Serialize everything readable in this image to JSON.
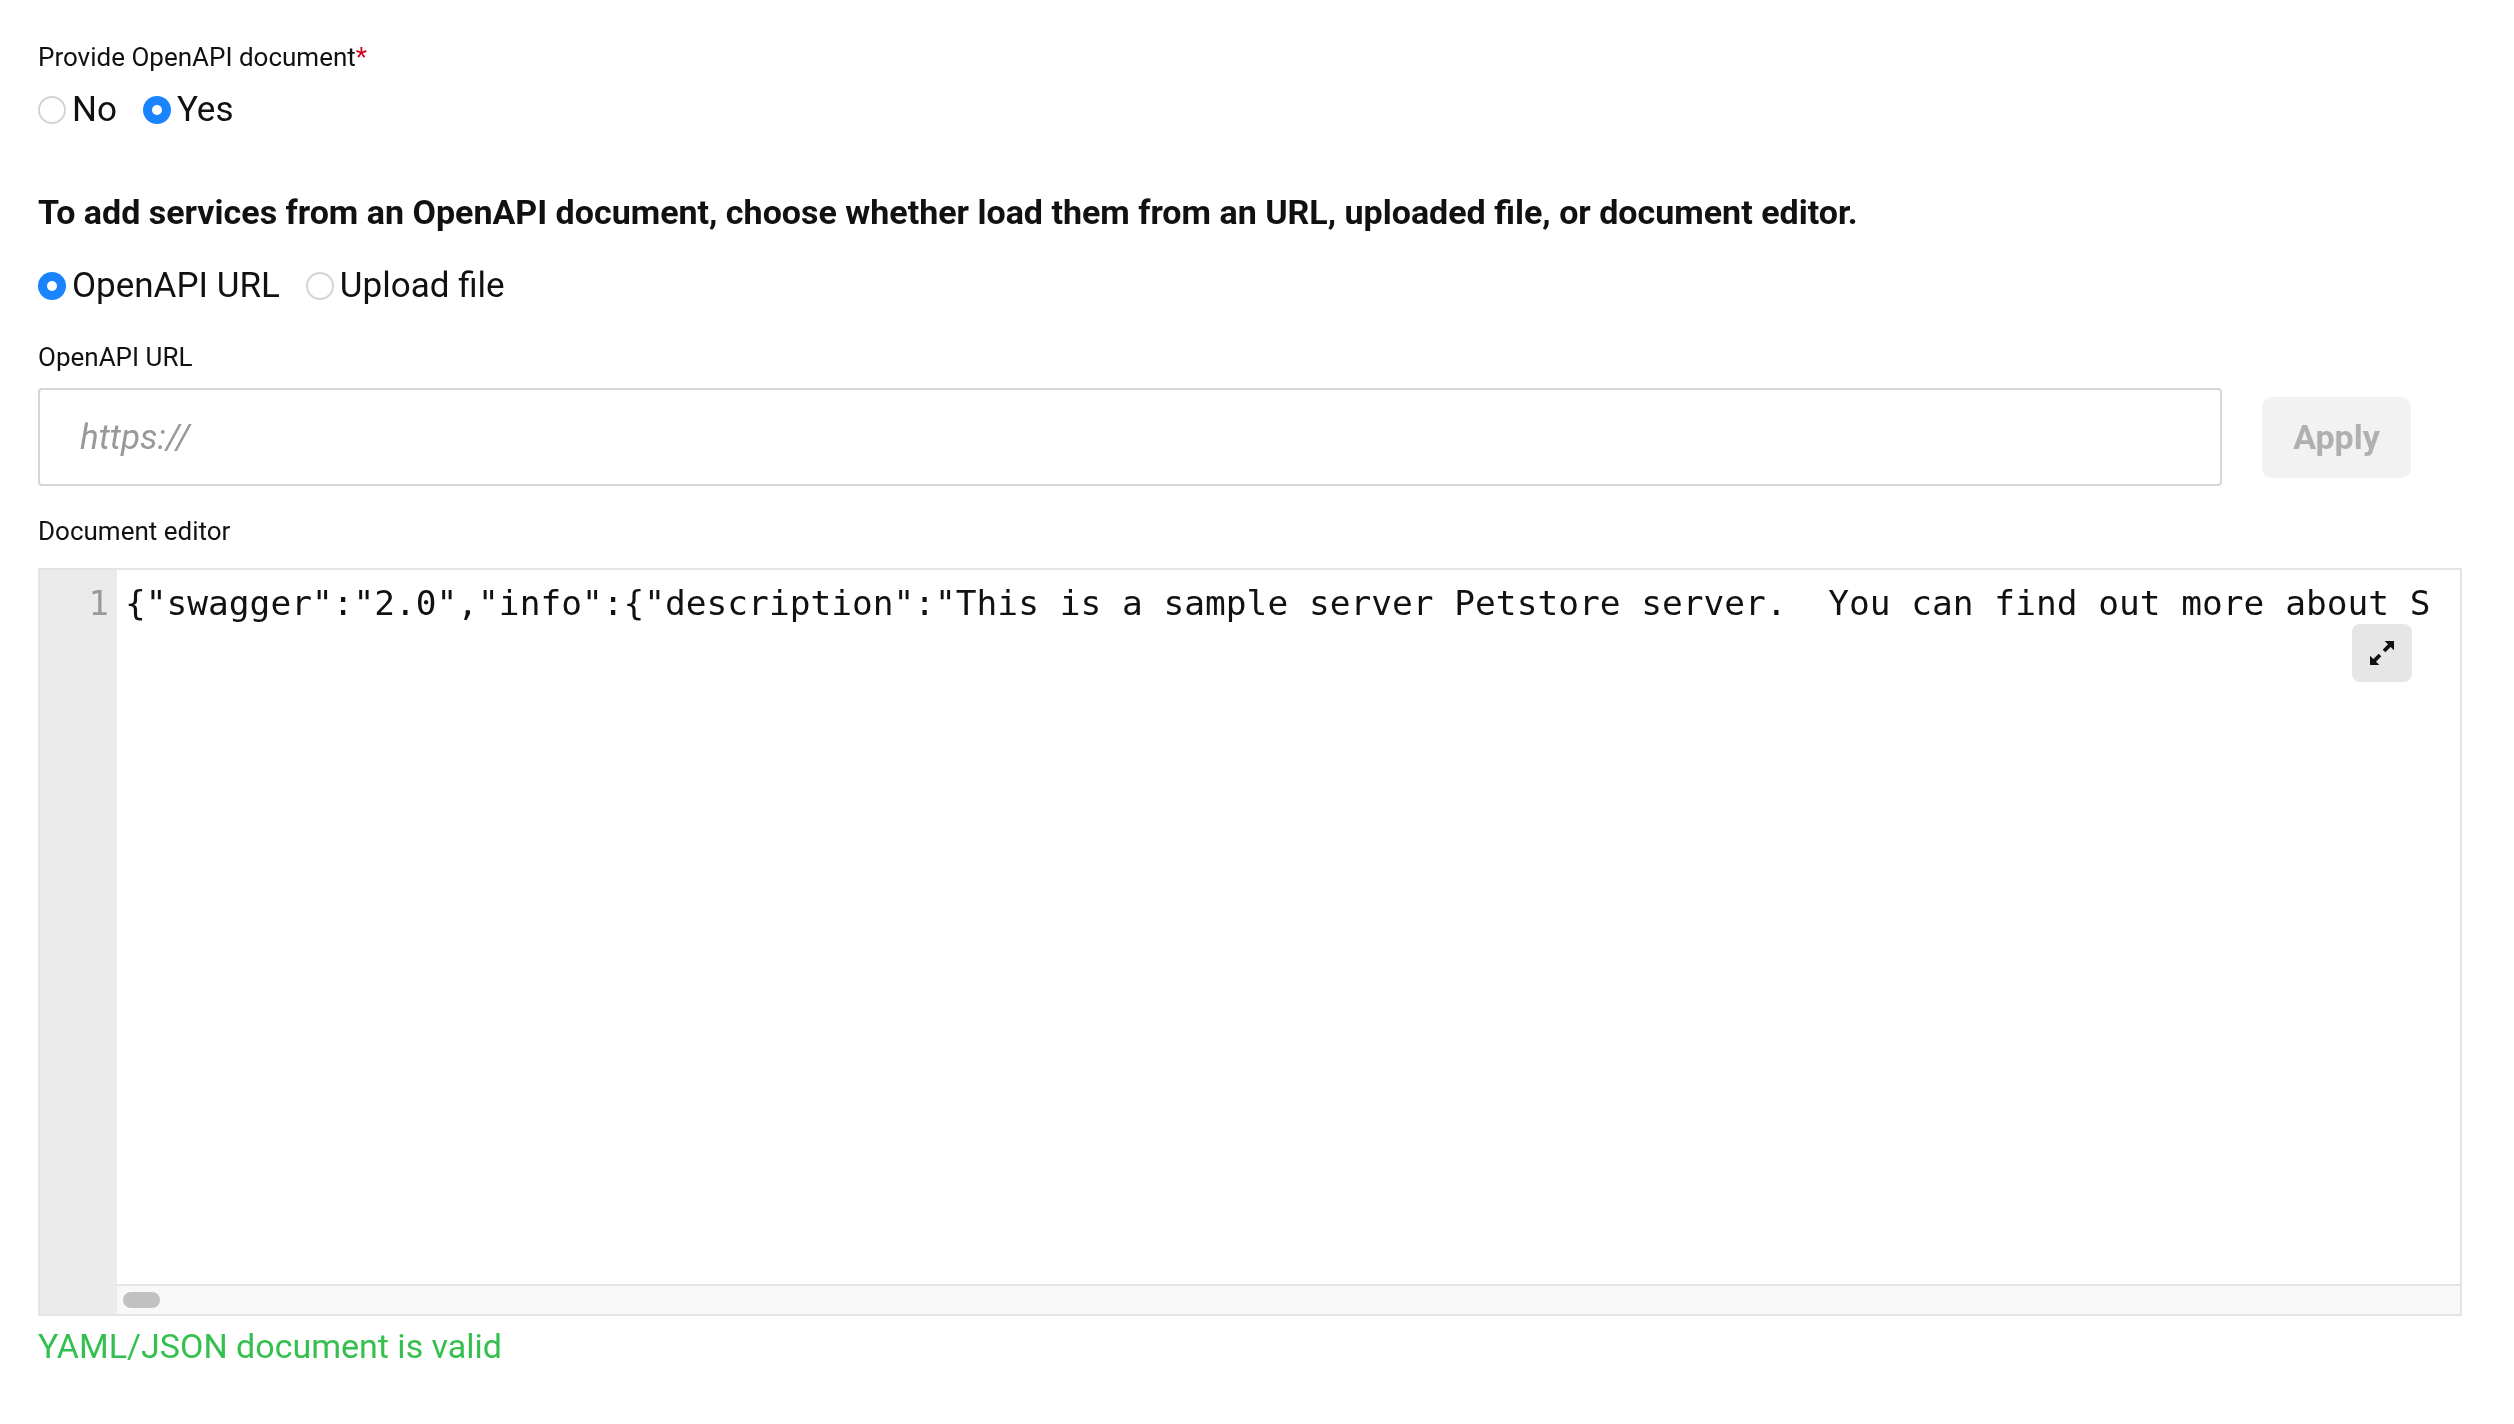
{
  "provide_document": {
    "label": "Provide OpenAPI document",
    "required_mark": "*",
    "options": [
      {
        "label": "No",
        "selected": false
      },
      {
        "label": "Yes",
        "selected": true
      }
    ]
  },
  "instructions": "To add services from an OpenAPI document, choose whether load them from an URL, uploaded file, or document editor.",
  "source": {
    "options": [
      {
        "label": "OpenAPI URL",
        "selected": true
      },
      {
        "label": "Upload file",
        "selected": false
      }
    ]
  },
  "url_field": {
    "label": "OpenAPI URL",
    "placeholder": "https://",
    "apply_button": "Apply",
    "apply_disabled": true
  },
  "editor": {
    "label": "Document editor",
    "lines": [
      {
        "number": "1",
        "text": "{\"swagger\":\"2.0\",\"info\":{\"description\":\"This is a sample server Petstore server.  You can find out more about S"
      }
    ]
  },
  "validation": {
    "message": "YAML/JSON document is valid",
    "valid": true
  }
}
